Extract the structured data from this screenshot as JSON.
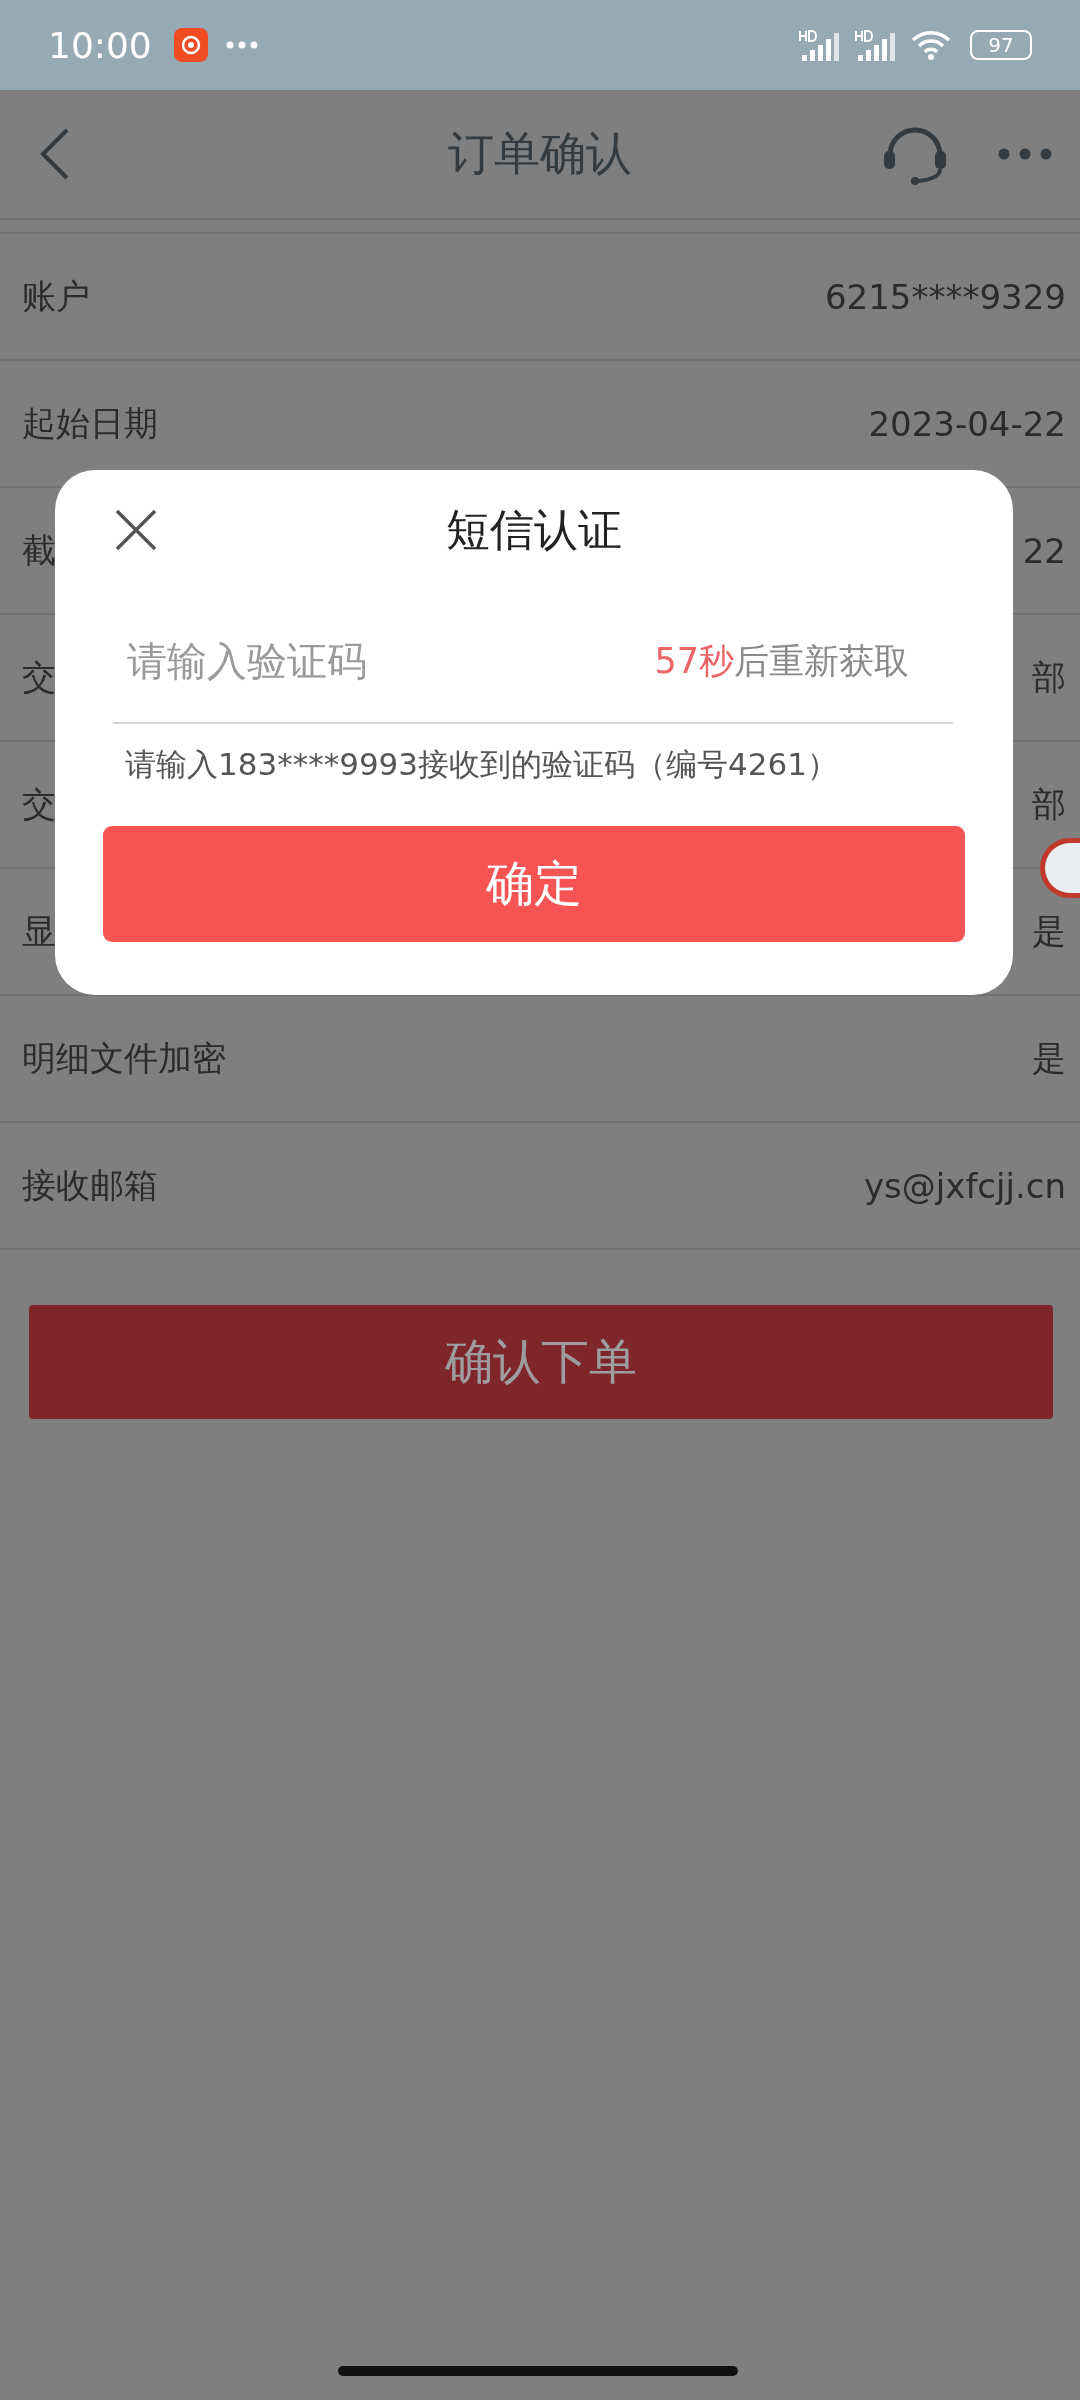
{
  "status_bar": {
    "time": "10:00",
    "battery": "97"
  },
  "header": {
    "title": "订单确认"
  },
  "rows": [
    {
      "label": "账户",
      "value": "6215****9329"
    },
    {
      "label": "起始日期",
      "value": "2023-04-22"
    },
    {
      "label": "截",
      "value": "22"
    },
    {
      "label": "交",
      "value": "部"
    },
    {
      "label": "交",
      "value": "部"
    },
    {
      "label": "显",
      "value": "是"
    },
    {
      "label": "明细文件加密",
      "value": "是"
    },
    {
      "label": "接收邮箱",
      "value": "ys@jxfcjj.cn"
    }
  ],
  "submit_button": "确认下单",
  "dialog": {
    "title": "短信认证",
    "placeholder": "请输入验证码",
    "countdown_seconds": "57秒",
    "countdown_suffix": "后重新获取",
    "hint": "请输入183****9993接收到的验证码（编号4261）",
    "confirm": "确定"
  }
}
